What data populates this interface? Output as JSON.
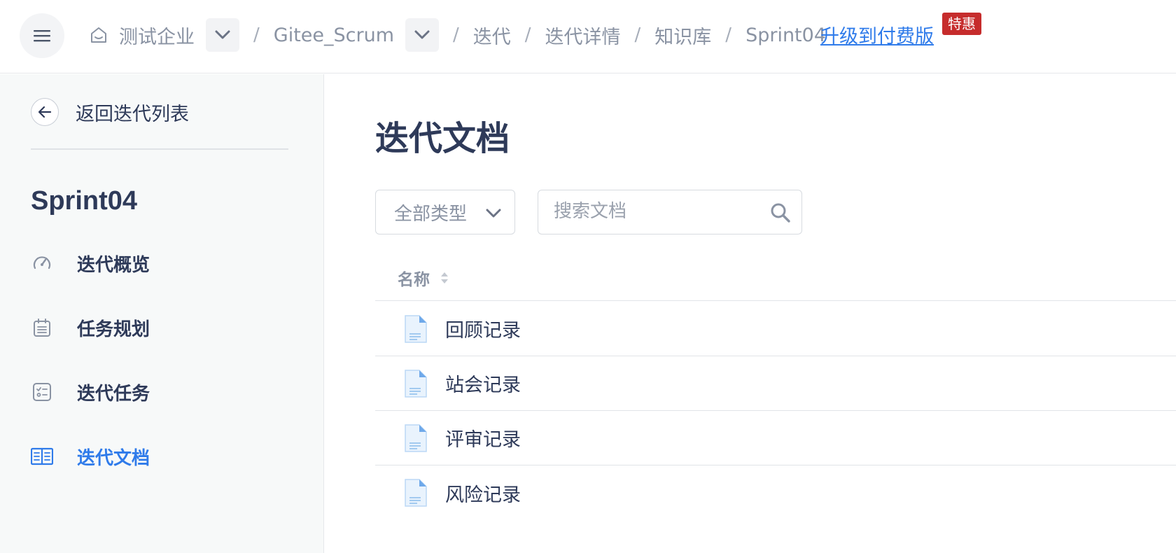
{
  "header": {
    "breadcrumb": [
      "测试企业",
      "Gitee_Scrum",
      "迭代",
      "迭代详情",
      "知识库",
      "Sprint04"
    ],
    "upgrade_link": "升级到付费版",
    "promo_badge": "特惠"
  },
  "sidebar": {
    "back_label": "返回迭代列表",
    "sprint_name": "Sprint04",
    "items": [
      {
        "label": "迭代概览",
        "icon": "speedometer-icon"
      },
      {
        "label": "任务规划",
        "icon": "calendar-list-icon"
      },
      {
        "label": "迭代任务",
        "icon": "task-checklist-icon"
      },
      {
        "label": "迭代文档",
        "icon": "book-icon",
        "active": true
      }
    ]
  },
  "main": {
    "title": "迭代文档",
    "type_filter": {
      "selected": "全部类型"
    },
    "search": {
      "placeholder": "搜索文档",
      "value": ""
    },
    "table": {
      "column_name": "名称",
      "rows": [
        {
          "name": "回顾记录"
        },
        {
          "name": "站会记录"
        },
        {
          "name": "评审记录"
        },
        {
          "name": "风险记录"
        }
      ]
    }
  },
  "colors": {
    "accent": "#2f7bea",
    "badge": "#c62c2c",
    "text": "#2e3a59",
    "muted": "#8a93a3",
    "sidebar_bg": "#f7f9f9"
  }
}
